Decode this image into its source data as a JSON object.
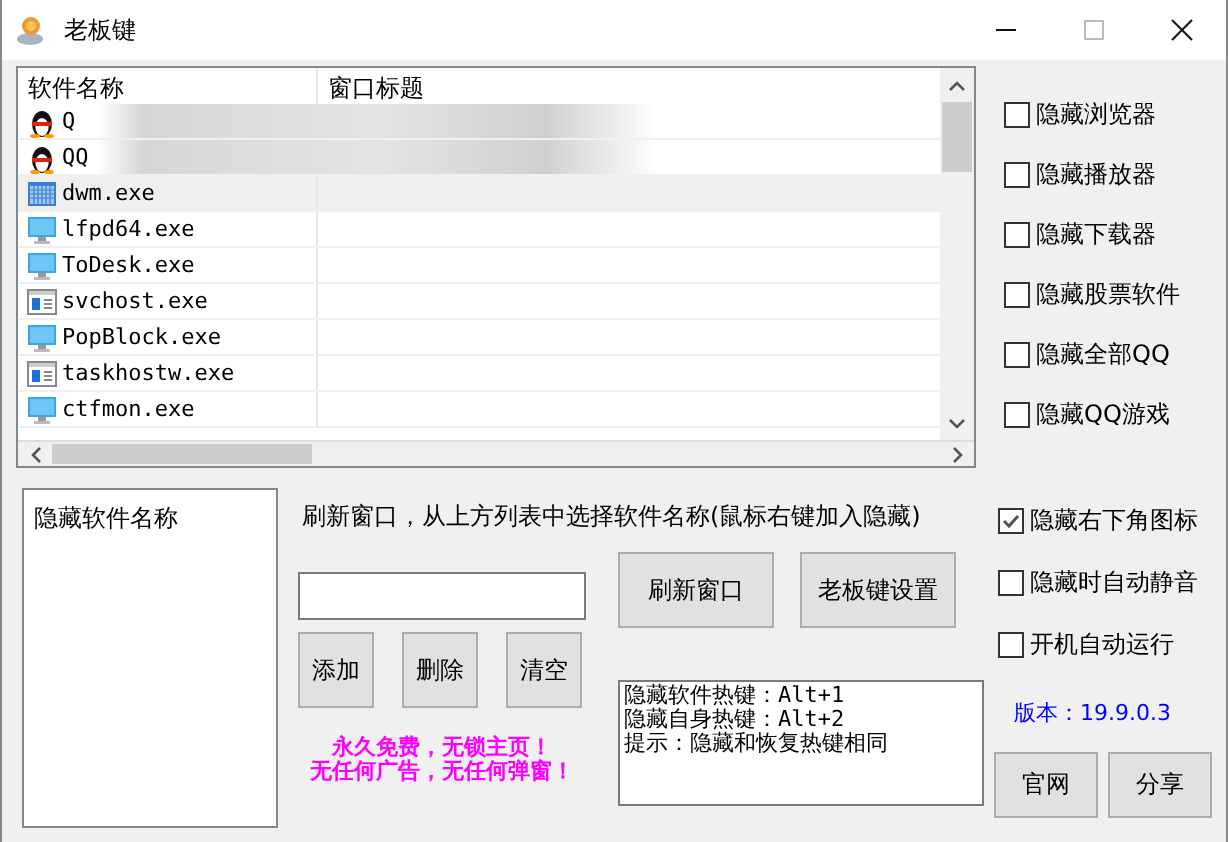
{
  "window": {
    "title": "老板键"
  },
  "process_list": {
    "columns": [
      "软件名称",
      "窗口标题"
    ],
    "rows": [
      {
        "kind": "penguin",
        "name": "Q",
        "blurred": true,
        "selected": false
      },
      {
        "kind": "penguin",
        "name": "QQ",
        "blurred": true,
        "selected": false
      },
      {
        "kind": "grid",
        "name": "dwm.exe",
        "blurred": false,
        "selected": true
      },
      {
        "kind": "monitor",
        "name": "lfpd64.exe",
        "blurred": false,
        "selected": false
      },
      {
        "kind": "monitor",
        "name": "ToDesk.exe",
        "blurred": false,
        "selected": false
      },
      {
        "kind": "app",
        "name": "svchost.exe",
        "blurred": false,
        "selected": false
      },
      {
        "kind": "monitor",
        "name": "PopBlock.exe",
        "blurred": false,
        "selected": false
      },
      {
        "kind": "app",
        "name": "taskhostw.exe",
        "blurred": false,
        "selected": false
      },
      {
        "kind": "monitor",
        "name": "ctfmon.exe",
        "blurred": false,
        "selected": false
      }
    ]
  },
  "hide_options": [
    {
      "label": "隐藏浏览器",
      "checked": false
    },
    {
      "label": "隐藏播放器",
      "checked": false
    },
    {
      "label": "隐藏下载器",
      "checked": false
    },
    {
      "label": "隐藏股票软件",
      "checked": false
    },
    {
      "label": "隐藏全部QQ",
      "checked": false
    },
    {
      "label": "隐藏QQ游戏",
      "checked": false
    }
  ],
  "hidden_list": {
    "header": "隐藏软件名称"
  },
  "instruction": "刷新窗口，从上方列表中选择软件名称(鼠标右键加入隐藏)",
  "edit_buttons": [
    "添加",
    "删除",
    "清空"
  ],
  "action_buttons": [
    "刷新窗口",
    "老板键设置"
  ],
  "settings": [
    {
      "label": "隐藏右下角图标",
      "checked": true
    },
    {
      "label": "隐藏时自动静音",
      "checked": false
    },
    {
      "label": "开机自动运行",
      "checked": false
    }
  ],
  "hotkey_info": [
    "隐藏软件热键：Alt+1",
    "隐藏自身热键：Alt+2",
    "提示：隐藏和恢复热键相同"
  ],
  "version": "版本：19.9.0.3",
  "promo": [
    "永久免费，无锁主页！",
    "无任何广告，无任何弹窗！"
  ],
  "footer_buttons": [
    "官网",
    "分享"
  ]
}
